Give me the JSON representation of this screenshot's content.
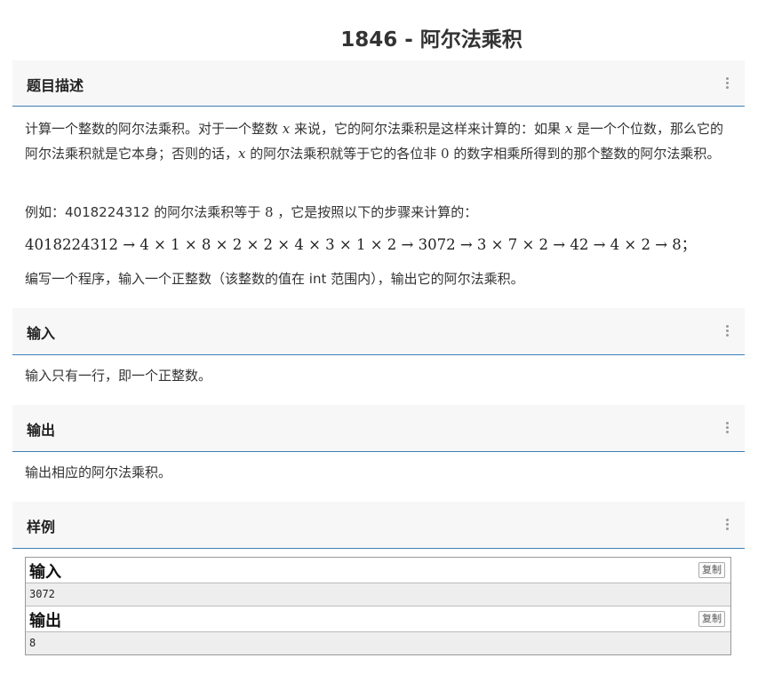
{
  "problem": {
    "title": "1846 - 阿尔法乘积"
  },
  "sections": {
    "description": {
      "header": "题目描述",
      "p1_a": "计算一个整数的阿尔法乘积。对于一个整数 ",
      "p1_x1": "x",
      "p1_b": " 来说，它的阿尔法乘积是这样来计算的：如果 ",
      "p1_x2": "x",
      "p1_c": " 是一个个位数，那么它的阿尔法乘积就是它本身；否则的话，",
      "p1_x3": "x",
      "p1_d": " 的阿尔法乘积就等于它的各位非 ",
      "p1_zero": "0",
      "p1_e": " 的数字相乘所得到的那个整数的阿尔法乘积。",
      "p2_a": "例如：4018224312 的阿尔法乘积等于 ",
      "p2_eight": "8",
      "p2_b": " ，它是按照以下的步骤来计算的：",
      "formula": "4018224312 → 4 × 1 × 8 × 2 × 2 × 4 × 3 × 1 × 2 → 3072 → 3 × 7 × 2 → 42 → 4 × 2 → 8；",
      "p3": "编写一个程序，输入一个正整数（该整数的值在 int 范围内），输出它的阿尔法乘积。"
    },
    "input": {
      "header": "输入",
      "text": "输入只有一行，即一个正整数。"
    },
    "output": {
      "header": "输出",
      "text": "输出相应的阿尔法乘积。"
    },
    "samples": {
      "header": "样例",
      "input_label": "输入",
      "input_value": "3072",
      "output_label": "输出",
      "output_value": "8",
      "copy_label": "复制"
    }
  },
  "icons": {
    "menu": "vertical-ellipsis-icon"
  },
  "colors": {
    "header_bg": "#f7f7f7",
    "accent_border": "#3c7fb8",
    "sample_body_bg": "#eeeeee"
  }
}
